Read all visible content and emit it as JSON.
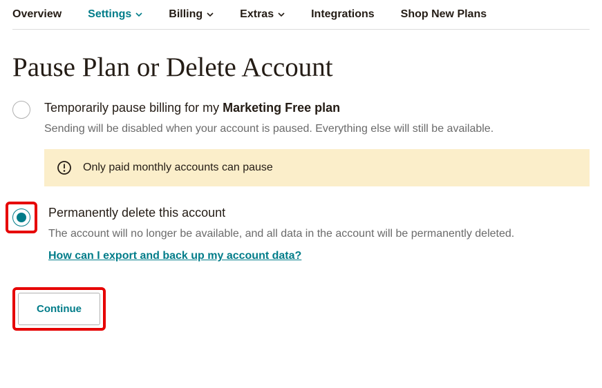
{
  "tabs": {
    "overview": "Overview",
    "settings": "Settings",
    "billing": "Billing",
    "extras": "Extras",
    "integrations": "Integrations",
    "shop": "Shop New Plans"
  },
  "heading": "Pause Plan or Delete Account",
  "pause": {
    "title_prefix": "Temporarily pause billing for my ",
    "plan_name": "Marketing Free plan",
    "desc": "Sending will be disabled when your account is paused. Everything else will still be available.",
    "warning": "Only paid monthly accounts can pause"
  },
  "delete": {
    "title": "Permanently delete this account",
    "desc": "The account will no longer be available, and all data in the account will be permanently deleted.",
    "link": "How can I export and back up my account data?"
  },
  "continue": "Continue"
}
